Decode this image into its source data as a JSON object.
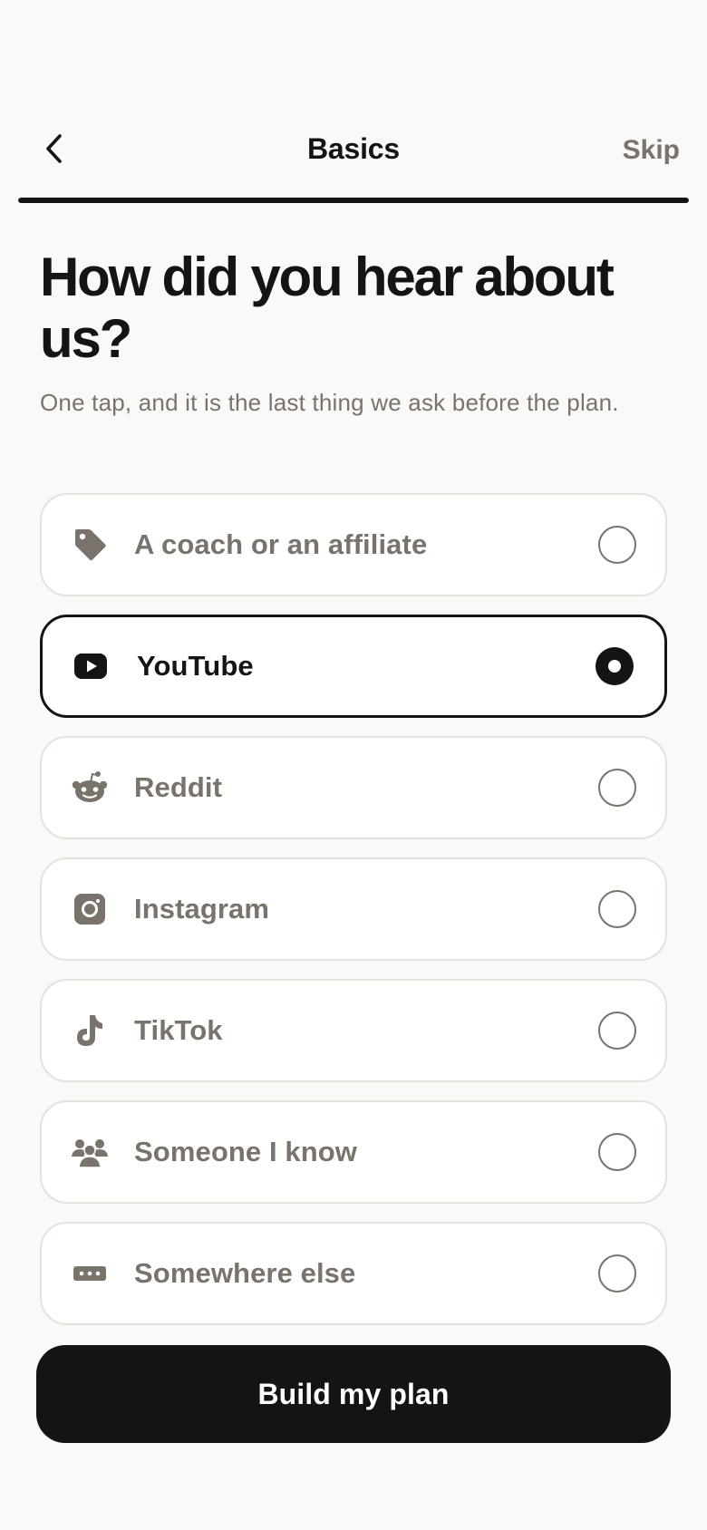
{
  "header": {
    "back_icon": "chevron-left-icon",
    "title": "Basics",
    "skip_label": "Skip",
    "progress_percent": 100
  },
  "question": {
    "title": "How did you hear about us?",
    "subtitle": "One tap, and it is the last thing we ask before the plan."
  },
  "options": [
    {
      "label": "A coach or an affiliate",
      "icon": "tag-icon",
      "selected": false
    },
    {
      "label": "YouTube",
      "icon": "youtube-icon",
      "selected": true
    },
    {
      "label": "Reddit",
      "icon": "reddit-icon",
      "selected": false
    },
    {
      "label": "Instagram",
      "icon": "instagram-icon",
      "selected": false
    },
    {
      "label": "TikTok",
      "icon": "tiktok-icon",
      "selected": false
    },
    {
      "label": "Someone I know",
      "icon": "people-icon",
      "selected": false
    },
    {
      "label": "Somewhere else",
      "icon": "dots-icon",
      "selected": false
    }
  ],
  "cta": {
    "label": "Build my plan"
  },
  "colors": {
    "background": "#faf9f7",
    "ink": "#161412",
    "muted": "#79736b",
    "card": "#ffffff",
    "card_border": "#e6e2db"
  }
}
